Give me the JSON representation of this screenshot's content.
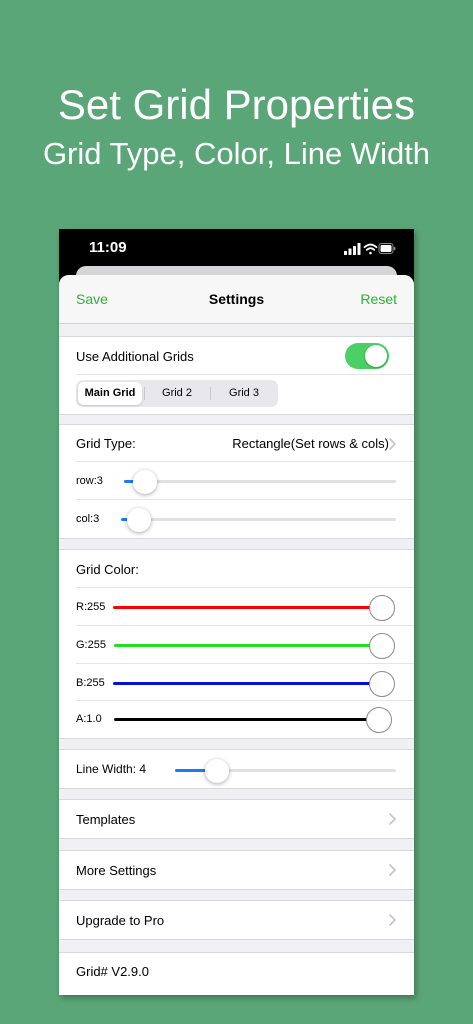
{
  "promo": {
    "title": "Set Grid Properties",
    "subtitle": "Grid Type, Color, Line Width"
  },
  "status_bar": {
    "time": "11:09",
    "icons": [
      "signal-icon",
      "wifi-icon",
      "battery-icon"
    ]
  },
  "navbar": {
    "save_label": "Save",
    "title": "Settings",
    "reset_label": "Reset"
  },
  "additional_grids": {
    "label": "Use Additional Grids",
    "enabled": true,
    "segments": [
      "Main Grid",
      "Grid 2",
      "Grid 3"
    ],
    "selected_segment": "Main Grid"
  },
  "grid_type": {
    "label": "Grid Type:",
    "value": "Rectangle(Set rows & cols)",
    "row_label": "row:3",
    "row_value": 3,
    "col_label": "col:3",
    "col_value": 3
  },
  "grid_color": {
    "label": "Grid Color:",
    "channels": [
      {
        "label": "R:255",
        "value": 255,
        "color": "#ff0000"
      },
      {
        "label": "G:255",
        "value": 255,
        "color": "#22e01e"
      },
      {
        "label": "B:255",
        "value": 255,
        "color": "#0010d8"
      },
      {
        "label": "A:1.0",
        "value": 1.0,
        "color": "#000000"
      }
    ]
  },
  "line_width": {
    "label": "Line Width: 4",
    "value": 4
  },
  "menu": {
    "templates": "Templates",
    "more_settings": "More Settings",
    "upgrade": "Upgrade to Pro",
    "version": "Grid# V2.9.0"
  },
  "colors": {
    "background": "#5ba678",
    "accent_green": "#2ab533",
    "toggle_on": "#4ad064",
    "slider_blue": "#1a7cf5"
  }
}
